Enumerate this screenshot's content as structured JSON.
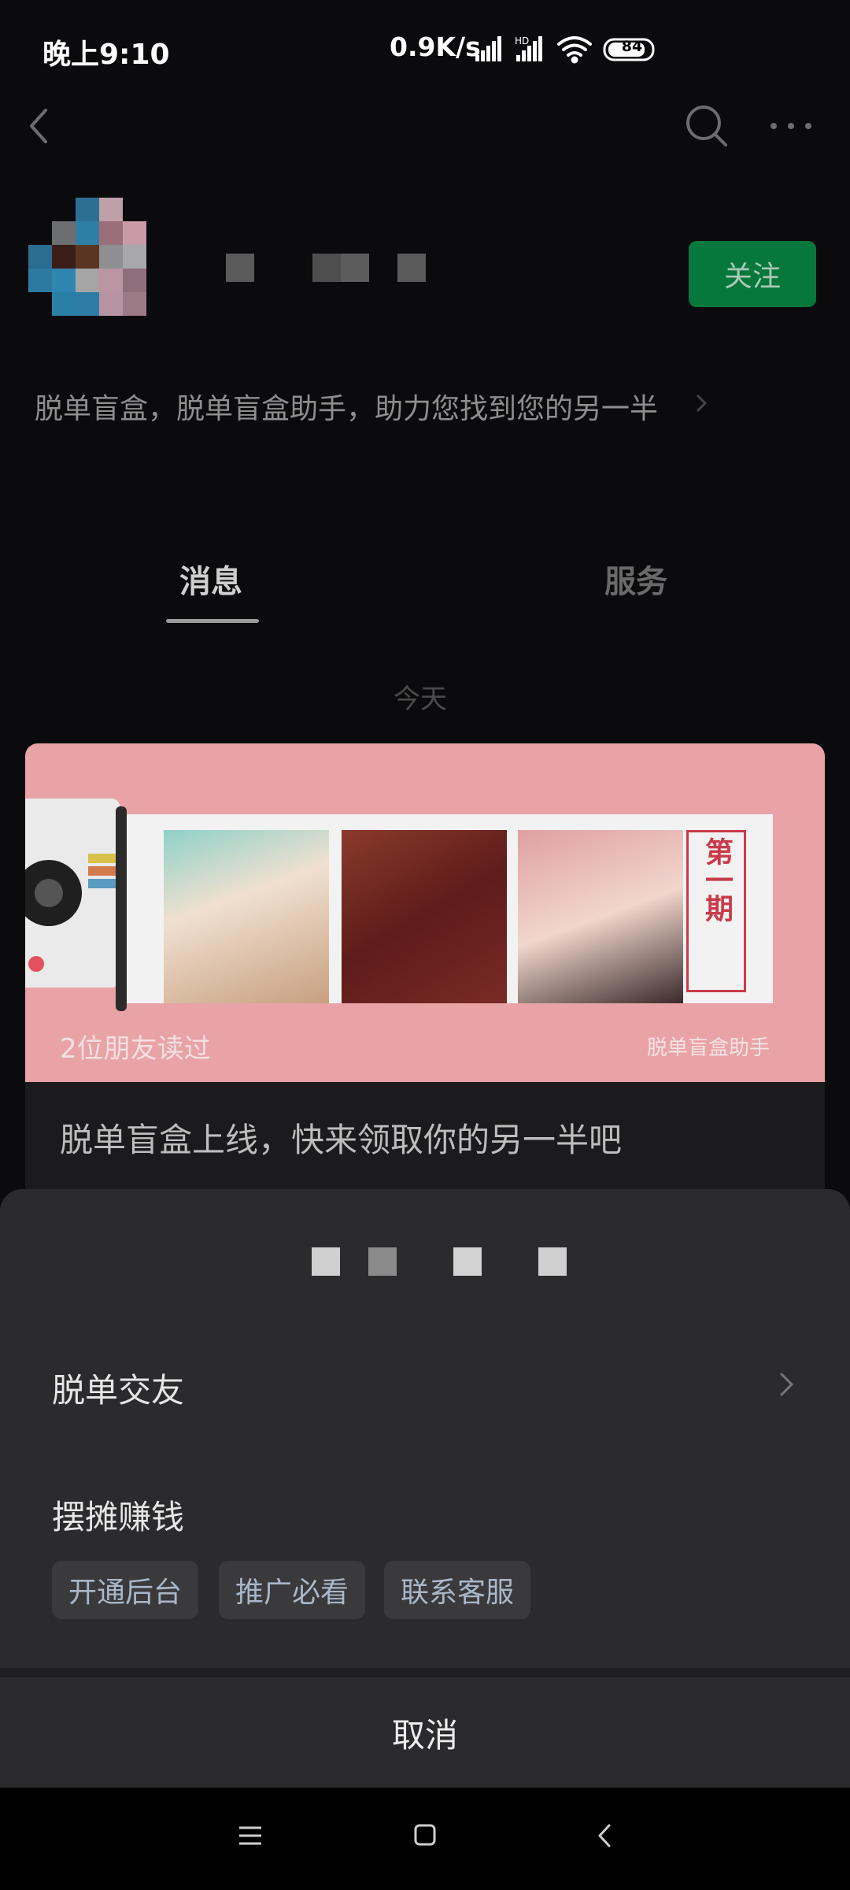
{
  "status_bar": {
    "time": "晚上9:10",
    "network_speed": "0.9K/s",
    "battery": "84"
  },
  "header": {
    "back_icon": "chevron-left-icon",
    "search_icon": "search-icon",
    "more_icon": "more-horizontal-icon"
  },
  "profile": {
    "follow_label": "关注",
    "description": "脱单盲盒，脱单盲盒助手，助力您找到您的另一半",
    "follow_color": "#07783b"
  },
  "tabs": [
    {
      "label": "消息",
      "active": true
    },
    {
      "label": "服务",
      "active": false
    }
  ],
  "feed": {
    "date_label": "今天",
    "article": {
      "read_by": "2位朋友读过",
      "watermark": "脱单盲盒助手",
      "issue_label": "第一期",
      "title": "脱单盲盒上线，快来领取你的另一半吧"
    }
  },
  "sheet": {
    "items": [
      {
        "label": "脱单交友"
      },
      {
        "label": "摆摊赚钱"
      }
    ],
    "chips": [
      "开通后台",
      "推广必看",
      "联系客服"
    ],
    "cancel_label": "取消"
  },
  "navbar": {
    "icons": [
      "menu-icon",
      "home-icon",
      "back-icon"
    ]
  }
}
